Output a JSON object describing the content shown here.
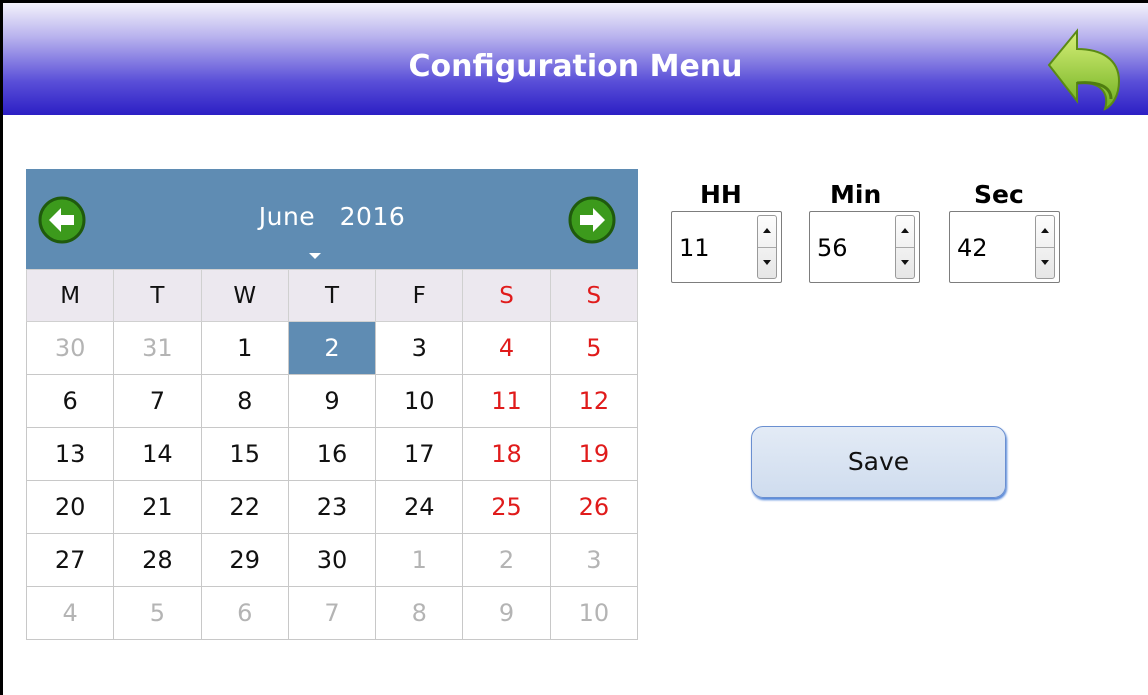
{
  "header": {
    "title": "Configuration Menu",
    "back_icon": "back-arrow-icon"
  },
  "calendar": {
    "month": "June",
    "year": "2016",
    "weekdays": [
      "M",
      "T",
      "W",
      "T",
      "F",
      "S",
      "S"
    ],
    "weeks": [
      [
        {
          "d": "30",
          "s": "muted"
        },
        {
          "d": "31",
          "s": "muted"
        },
        {
          "d": "1",
          "s": ""
        },
        {
          "d": "2",
          "s": "selected"
        },
        {
          "d": "3",
          "s": ""
        },
        {
          "d": "4",
          "s": "weekend"
        },
        {
          "d": "5",
          "s": "weekend"
        }
      ],
      [
        {
          "d": "6",
          "s": ""
        },
        {
          "d": "7",
          "s": ""
        },
        {
          "d": "8",
          "s": ""
        },
        {
          "d": "9",
          "s": ""
        },
        {
          "d": "10",
          "s": ""
        },
        {
          "d": "11",
          "s": "weekend"
        },
        {
          "d": "12",
          "s": "weekend"
        }
      ],
      [
        {
          "d": "13",
          "s": ""
        },
        {
          "d": "14",
          "s": ""
        },
        {
          "d": "15",
          "s": ""
        },
        {
          "d": "16",
          "s": ""
        },
        {
          "d": "17",
          "s": ""
        },
        {
          "d": "18",
          "s": "weekend"
        },
        {
          "d": "19",
          "s": "weekend"
        }
      ],
      [
        {
          "d": "20",
          "s": ""
        },
        {
          "d": "21",
          "s": ""
        },
        {
          "d": "22",
          "s": ""
        },
        {
          "d": "23",
          "s": ""
        },
        {
          "d": "24",
          "s": ""
        },
        {
          "d": "25",
          "s": "weekend"
        },
        {
          "d": "26",
          "s": "weekend"
        }
      ],
      [
        {
          "d": "27",
          "s": ""
        },
        {
          "d": "28",
          "s": ""
        },
        {
          "d": "29",
          "s": ""
        },
        {
          "d": "30",
          "s": ""
        },
        {
          "d": "1",
          "s": "muted"
        },
        {
          "d": "2",
          "s": "muted"
        },
        {
          "d": "3",
          "s": "muted"
        }
      ],
      [
        {
          "d": "4",
          "s": "muted"
        },
        {
          "d": "5",
          "s": "muted"
        },
        {
          "d": "6",
          "s": "muted"
        },
        {
          "d": "7",
          "s": "muted"
        },
        {
          "d": "8",
          "s": "muted"
        },
        {
          "d": "9",
          "s": "muted"
        },
        {
          "d": "10",
          "s": "muted"
        }
      ]
    ]
  },
  "time": {
    "hh": {
      "label": "HH",
      "value": "11"
    },
    "min": {
      "label": "Min",
      "value": "56"
    },
    "sec": {
      "label": "Sec",
      "value": "42"
    }
  },
  "save_label": "Save",
  "colors": {
    "header_dark": "#2c1fc4",
    "calendar_accent": "#5f8cb3",
    "weekend": "#e01b1b",
    "muted": "#b4b4b4",
    "nav_green": "#3c9a1c"
  }
}
